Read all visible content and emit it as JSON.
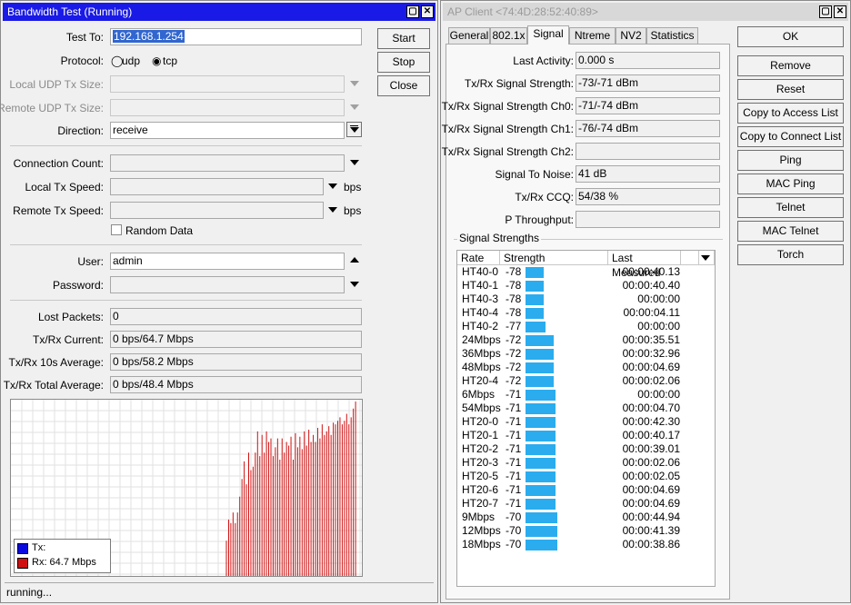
{
  "bw": {
    "title": "Bandwidth Test (Running)",
    "test_to_label": "Test To:",
    "test_to_value": "192.168.1.254",
    "protocol_label": "Protocol:",
    "protocol_udp": "udp",
    "protocol_tcp": "tcp",
    "protocol_selected": "tcp",
    "local_udp_label": "Local UDP Tx Size:",
    "remote_udp_label": "Remote UDP Tx Size:",
    "direction_label": "Direction:",
    "direction_value": "receive",
    "conn_count_label": "Connection Count:",
    "local_tx_label": "Local Tx Speed:",
    "remote_tx_label": "Remote Tx Speed:",
    "bps": "bps",
    "random_data_label": "Random Data",
    "user_label": "User:",
    "user_value": "admin",
    "password_label": "Password:",
    "lost_label": "Lost Packets:",
    "lost_value": "0",
    "current_label": "Tx/Rx Current:",
    "current_value": "0 bps/64.7 Mbps",
    "avg10_label": "Tx/Rx 10s Average:",
    "avg10_value": "0 bps/58.2 Mbps",
    "total_label": "Tx/Rx Total Average:",
    "total_value": "0 bps/48.4 Mbps",
    "buttons": {
      "start": "Start",
      "stop": "Stop",
      "close": "Close"
    },
    "legend": {
      "tx": "Tx:",
      "rx": "Rx:  64.7 Mbps",
      "tx_color": "#0a0ae0",
      "rx_color": "#d01010"
    },
    "status": "running...",
    "rx_graph_fractions": [
      0.2,
      0.32,
      0.3,
      0.36,
      0.3,
      0.36,
      0.45,
      0.55,
      0.65,
      0.52,
      0.7,
      0.6,
      0.62,
      0.7,
      0.82,
      0.68,
      0.8,
      0.7,
      0.82,
      0.76,
      0.78,
      0.68,
      0.73,
      0.78,
      0.66,
      0.78,
      0.7,
      0.76,
      0.74,
      0.79,
      0.66,
      0.81,
      0.73,
      0.79,
      0.72,
      0.82,
      0.74,
      0.83,
      0.76,
      0.8,
      0.76,
      0.84,
      0.78,
      0.86,
      0.8,
      0.82,
      0.85,
      0.8,
      0.87,
      0.86,
      0.88,
      0.9,
      0.86,
      0.88,
      0.92,
      0.86,
      0.9,
      0.95,
      0.99
    ]
  },
  "ap": {
    "title": "AP Client <74:4D:28:52:40:89>",
    "tabs": [
      "General",
      "802.1x",
      "Signal",
      "Ntreme",
      "NV2",
      "Statistics"
    ],
    "active_tab": "Signal",
    "last_activity_label": "Last Activity:",
    "last_activity_value": "0.000 s",
    "sig_strength_label": "Tx/Rx Signal Strength:",
    "sig_strength_value": "-73/-71 dBm",
    "ch0_label": "Tx/Rx Signal Strength Ch0:",
    "ch0_value": "-71/-74 dBm",
    "ch1_label": "Tx/Rx Signal Strength Ch1:",
    "ch1_value": "-76/-74 dBm",
    "ch2_label": "Tx/Rx Signal Strength Ch2:",
    "ch2_value": "",
    "snr_label": "Signal To Noise:",
    "snr_value": "41 dB",
    "ccq_label": "Tx/Rx CCQ:",
    "ccq_value": "54/38 %",
    "pthroughput_label": "P Throughput:",
    "pthroughput_value": "",
    "group_title": "Signal Strengths",
    "columns": {
      "rate": "Rate",
      "strength": "Strength",
      "last": "Last Measured"
    },
    "rows": [
      {
        "rate": "HT40-0",
        "strength": "-78",
        "time": "00:00:40.13"
      },
      {
        "rate": "HT40-1",
        "strength": "-78",
        "time": "00:00:40.40"
      },
      {
        "rate": "HT40-3",
        "strength": "-78",
        "time": "00:00:00"
      },
      {
        "rate": "HT40-4",
        "strength": "-78",
        "time": "00:00:04.11"
      },
      {
        "rate": "HT40-2",
        "strength": "-77",
        "time": "00:00:00"
      },
      {
        "rate": "24Mbps",
        "strength": "-72",
        "time": "00:00:35.51"
      },
      {
        "rate": "36Mbps",
        "strength": "-72",
        "time": "00:00:32.96"
      },
      {
        "rate": "48Mbps",
        "strength": "-72",
        "time": "00:00:04.69"
      },
      {
        "rate": "HT20-4",
        "strength": "-72",
        "time": "00:00:02.06"
      },
      {
        "rate": "6Mbps",
        "strength": "-71",
        "time": "00:00:00"
      },
      {
        "rate": "54Mbps",
        "strength": "-71",
        "time": "00:00:04.70"
      },
      {
        "rate": "HT20-0",
        "strength": "-71",
        "time": "00:00:42.30"
      },
      {
        "rate": "HT20-1",
        "strength": "-71",
        "time": "00:00:40.17"
      },
      {
        "rate": "HT20-2",
        "strength": "-71",
        "time": "00:00:39.01"
      },
      {
        "rate": "HT20-3",
        "strength": "-71",
        "time": "00:00:02.06"
      },
      {
        "rate": "HT20-5",
        "strength": "-71",
        "time": "00:00:02.05"
      },
      {
        "rate": "HT20-6",
        "strength": "-71",
        "time": "00:00:04.69"
      },
      {
        "rate": "HT20-7",
        "strength": "-71",
        "time": "00:00:04.69"
      },
      {
        "rate": "9Mbps",
        "strength": "-70",
        "time": "00:00:44.94"
      },
      {
        "rate": "12Mbps",
        "strength": "-70",
        "time": "00:00:41.39"
      },
      {
        "rate": "18Mbps",
        "strength": "-70",
        "time": "00:00:38.86"
      }
    ],
    "bar_color": "#2aacef",
    "buttons": [
      "OK",
      "Remove",
      "Reset",
      "Copy to Access List",
      "Copy to Connect List",
      "Ping",
      "MAC Ping",
      "Telnet",
      "MAC Telnet",
      "Torch"
    ]
  }
}
